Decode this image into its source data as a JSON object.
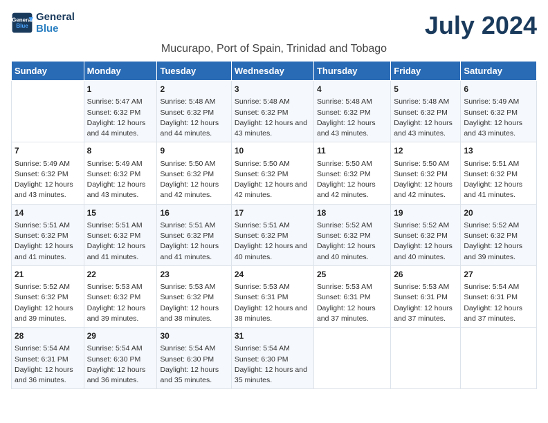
{
  "header": {
    "logo_line1": "General",
    "logo_line2": "Blue",
    "title": "July 2024",
    "subtitle": "Mucurapo, Port of Spain, Trinidad and Tobago"
  },
  "weekdays": [
    "Sunday",
    "Monday",
    "Tuesday",
    "Wednesday",
    "Thursday",
    "Friday",
    "Saturday"
  ],
  "weeks": [
    [
      {
        "day": "",
        "sunrise": "",
        "sunset": "",
        "daylight": ""
      },
      {
        "day": "1",
        "sunrise": "Sunrise: 5:47 AM",
        "sunset": "Sunset: 6:32 PM",
        "daylight": "Daylight: 12 hours and 44 minutes."
      },
      {
        "day": "2",
        "sunrise": "Sunrise: 5:48 AM",
        "sunset": "Sunset: 6:32 PM",
        "daylight": "Daylight: 12 hours and 44 minutes."
      },
      {
        "day": "3",
        "sunrise": "Sunrise: 5:48 AM",
        "sunset": "Sunset: 6:32 PM",
        "daylight": "Daylight: 12 hours and 43 minutes."
      },
      {
        "day": "4",
        "sunrise": "Sunrise: 5:48 AM",
        "sunset": "Sunset: 6:32 PM",
        "daylight": "Daylight: 12 hours and 43 minutes."
      },
      {
        "day": "5",
        "sunrise": "Sunrise: 5:48 AM",
        "sunset": "Sunset: 6:32 PM",
        "daylight": "Daylight: 12 hours and 43 minutes."
      },
      {
        "day": "6",
        "sunrise": "Sunrise: 5:49 AM",
        "sunset": "Sunset: 6:32 PM",
        "daylight": "Daylight: 12 hours and 43 minutes."
      }
    ],
    [
      {
        "day": "7",
        "sunrise": "Sunrise: 5:49 AM",
        "sunset": "Sunset: 6:32 PM",
        "daylight": "Daylight: 12 hours and 43 minutes."
      },
      {
        "day": "8",
        "sunrise": "Sunrise: 5:49 AM",
        "sunset": "Sunset: 6:32 PM",
        "daylight": "Daylight: 12 hours and 43 minutes."
      },
      {
        "day": "9",
        "sunrise": "Sunrise: 5:50 AM",
        "sunset": "Sunset: 6:32 PM",
        "daylight": "Daylight: 12 hours and 42 minutes."
      },
      {
        "day": "10",
        "sunrise": "Sunrise: 5:50 AM",
        "sunset": "Sunset: 6:32 PM",
        "daylight": "Daylight: 12 hours and 42 minutes."
      },
      {
        "day": "11",
        "sunrise": "Sunrise: 5:50 AM",
        "sunset": "Sunset: 6:32 PM",
        "daylight": "Daylight: 12 hours and 42 minutes."
      },
      {
        "day": "12",
        "sunrise": "Sunrise: 5:50 AM",
        "sunset": "Sunset: 6:32 PM",
        "daylight": "Daylight: 12 hours and 42 minutes."
      },
      {
        "day": "13",
        "sunrise": "Sunrise: 5:51 AM",
        "sunset": "Sunset: 6:32 PM",
        "daylight": "Daylight: 12 hours and 41 minutes."
      }
    ],
    [
      {
        "day": "14",
        "sunrise": "Sunrise: 5:51 AM",
        "sunset": "Sunset: 6:32 PM",
        "daylight": "Daylight: 12 hours and 41 minutes."
      },
      {
        "day": "15",
        "sunrise": "Sunrise: 5:51 AM",
        "sunset": "Sunset: 6:32 PM",
        "daylight": "Daylight: 12 hours and 41 minutes."
      },
      {
        "day": "16",
        "sunrise": "Sunrise: 5:51 AM",
        "sunset": "Sunset: 6:32 PM",
        "daylight": "Daylight: 12 hours and 41 minutes."
      },
      {
        "day": "17",
        "sunrise": "Sunrise: 5:51 AM",
        "sunset": "Sunset: 6:32 PM",
        "daylight": "Daylight: 12 hours and 40 minutes."
      },
      {
        "day": "18",
        "sunrise": "Sunrise: 5:52 AM",
        "sunset": "Sunset: 6:32 PM",
        "daylight": "Daylight: 12 hours and 40 minutes."
      },
      {
        "day": "19",
        "sunrise": "Sunrise: 5:52 AM",
        "sunset": "Sunset: 6:32 PM",
        "daylight": "Daylight: 12 hours and 40 minutes."
      },
      {
        "day": "20",
        "sunrise": "Sunrise: 5:52 AM",
        "sunset": "Sunset: 6:32 PM",
        "daylight": "Daylight: 12 hours and 39 minutes."
      }
    ],
    [
      {
        "day": "21",
        "sunrise": "Sunrise: 5:52 AM",
        "sunset": "Sunset: 6:32 PM",
        "daylight": "Daylight: 12 hours and 39 minutes."
      },
      {
        "day": "22",
        "sunrise": "Sunrise: 5:53 AM",
        "sunset": "Sunset: 6:32 PM",
        "daylight": "Daylight: 12 hours and 39 minutes."
      },
      {
        "day": "23",
        "sunrise": "Sunrise: 5:53 AM",
        "sunset": "Sunset: 6:32 PM",
        "daylight": "Daylight: 12 hours and 38 minutes."
      },
      {
        "day": "24",
        "sunrise": "Sunrise: 5:53 AM",
        "sunset": "Sunset: 6:31 PM",
        "daylight": "Daylight: 12 hours and 38 minutes."
      },
      {
        "day": "25",
        "sunrise": "Sunrise: 5:53 AM",
        "sunset": "Sunset: 6:31 PM",
        "daylight": "Daylight: 12 hours and 37 minutes."
      },
      {
        "day": "26",
        "sunrise": "Sunrise: 5:53 AM",
        "sunset": "Sunset: 6:31 PM",
        "daylight": "Daylight: 12 hours and 37 minutes."
      },
      {
        "day": "27",
        "sunrise": "Sunrise: 5:54 AM",
        "sunset": "Sunset: 6:31 PM",
        "daylight": "Daylight: 12 hours and 37 minutes."
      }
    ],
    [
      {
        "day": "28",
        "sunrise": "Sunrise: 5:54 AM",
        "sunset": "Sunset: 6:31 PM",
        "daylight": "Daylight: 12 hours and 36 minutes."
      },
      {
        "day": "29",
        "sunrise": "Sunrise: 5:54 AM",
        "sunset": "Sunset: 6:30 PM",
        "daylight": "Daylight: 12 hours and 36 minutes."
      },
      {
        "day": "30",
        "sunrise": "Sunrise: 5:54 AM",
        "sunset": "Sunset: 6:30 PM",
        "daylight": "Daylight: 12 hours and 35 minutes."
      },
      {
        "day": "31",
        "sunrise": "Sunrise: 5:54 AM",
        "sunset": "Sunset: 6:30 PM",
        "daylight": "Daylight: 12 hours and 35 minutes."
      },
      {
        "day": "",
        "sunrise": "",
        "sunset": "",
        "daylight": ""
      },
      {
        "day": "",
        "sunrise": "",
        "sunset": "",
        "daylight": ""
      },
      {
        "day": "",
        "sunrise": "",
        "sunset": "",
        "daylight": ""
      }
    ]
  ]
}
